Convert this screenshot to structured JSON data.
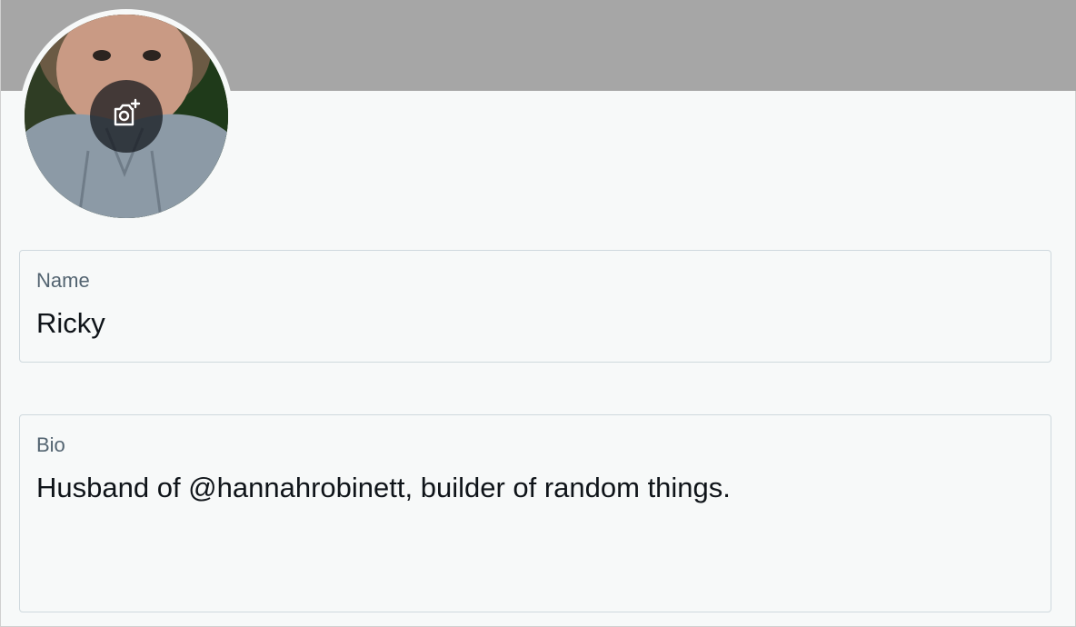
{
  "profile": {
    "avatar": {
      "alt": "Profile photo",
      "action_icon": "add-photo-camera-icon"
    },
    "fields": {
      "name": {
        "label": "Name",
        "value": "Ricky"
      },
      "bio": {
        "label": "Bio",
        "value": "Husband of @hannahrobinett, builder of random things."
      }
    }
  },
  "colors": {
    "banner": "#a6a6a6",
    "background": "#f7f9f9",
    "field_border": "#cfd9de",
    "label": "#536471",
    "text": "#0f1419"
  }
}
